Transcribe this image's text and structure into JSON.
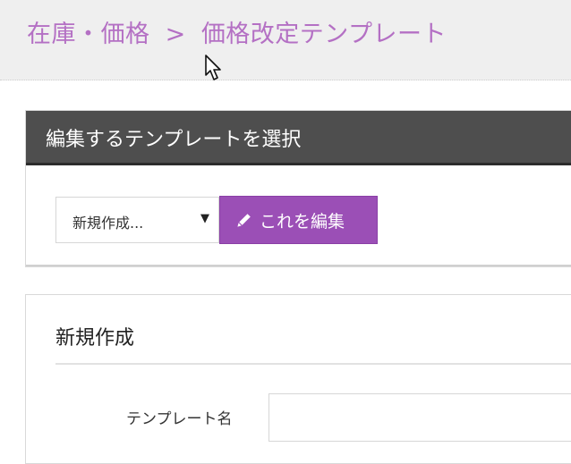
{
  "breadcrumb": {
    "parent": "在庫・価格",
    "separator": ">",
    "current": "価格改定テンプレート"
  },
  "select_panel": {
    "title": "編集するテンプレートを選択",
    "select_value": "新規作成...",
    "edit_button_label": "これを編集"
  },
  "new_panel": {
    "title": "新規作成",
    "template_name_label": "テンプレート名",
    "template_name_value": ""
  },
  "colors": {
    "accent": "#9b4fb6",
    "breadcrumb": "#b470c4",
    "panel_header": "#4e4e4e"
  },
  "icons": {
    "edit_button_icon": "pencil-icon",
    "select_icon": "caret-down-icon",
    "cursor": "mouse-pointer-icon"
  }
}
